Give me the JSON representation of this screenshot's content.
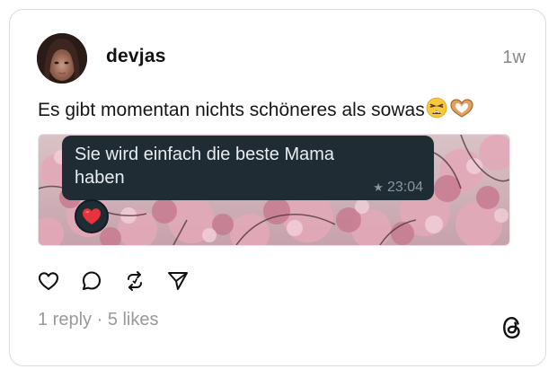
{
  "post": {
    "username": "devjas",
    "timestamp": "1w",
    "text": "Es gibt momentan nichts schöneres als sowas",
    "emojis": [
      "weary-face",
      "heart-hands"
    ]
  },
  "media": {
    "bubble_text": "Sie wird einfach die beste Mama haben",
    "bubble_time": "23:04",
    "reaction": "red-heart"
  },
  "actions": {
    "like": "heart-icon",
    "reply": "comment-icon",
    "repost": "repost-icon",
    "share": "send-icon"
  },
  "stats": {
    "replies": "1 reply",
    "separator": " · ",
    "likes": "5 likes"
  },
  "colors": {
    "bubble_bg": "#1f2c33",
    "bubble_text": "#e9edef",
    "bubble_time": "#8696a0",
    "heart": "#e8323c",
    "muted": "#999999"
  }
}
